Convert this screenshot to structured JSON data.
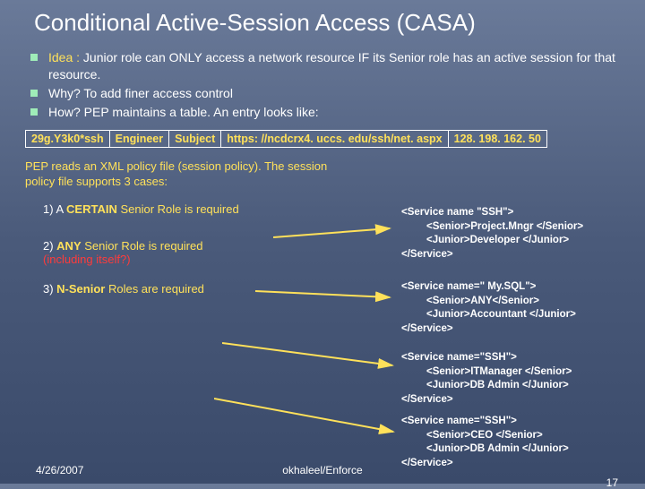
{
  "title": "Conditional Active-Session Access (CASA)",
  "bullets": [
    {
      "label": "Idea :",
      "text": " Junior role can ONLY access a network resource IF its Senior role has an active session for that resource."
    },
    {
      "label": "",
      "text": "Why? To add finer access control"
    },
    {
      "label": "",
      "text": "How? PEP maintains a table. An entry looks like:"
    }
  ],
  "table": {
    "c0": "29g.Y3k0*ssh",
    "c1": "Engineer",
    "c2": "Subject",
    "c3": "https: //ncdcrx4. uccs. edu/ssh/net. aspx",
    "c4": "128. 198. 162. 50"
  },
  "pep_text": "PEP reads an XML policy file (session policy). The session policy file supports 3 cases:",
  "cases": {
    "c1_pre": "1) A ",
    "c1_bold": "CERTAIN",
    "c1_post": " Senior Role is required",
    "c2_pre": "2) ",
    "c2_bold": "ANY",
    "c2_post": " Senior Role is required",
    "c2_danger": "(including itself?)",
    "c3_pre": "3) ",
    "c3_bold": "N-Senior",
    "c3_post": " Roles are required"
  },
  "xml": {
    "b1": {
      "l1": "<Service name \"SSH\">",
      "l2": "<Senior>Project.Mngr </Senior>",
      "l3": "<Junior>Developer </Junior>",
      "l4": "</Service>"
    },
    "b2": {
      "l1": "<Service name=\" My.SQL\">",
      "l2": "<Senior>ANY</Senior>",
      "l3": "<Junior>Accountant </Junior>",
      "l4": "</Service>"
    },
    "b3": {
      "l1": "<Service name=\"SSH\">",
      "l2": "<Senior>ITManager </Senior>",
      "l3": "<Junior>DB Admin </Junior>",
      "l4": "</Service>"
    },
    "b4": {
      "l1": "<Service name=\"SSH\">",
      "l2": "<Senior>CEO </Senior>",
      "l3": "<Junior>DB Admin </Junior>",
      "l4": "</Service>"
    }
  },
  "footer": {
    "date": "4/26/2007",
    "center": "okhaleel/Enforce",
    "page": "17"
  }
}
